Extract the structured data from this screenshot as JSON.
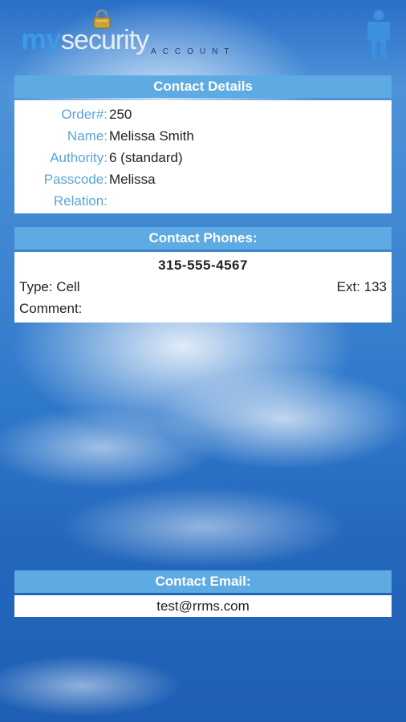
{
  "header": {
    "logo_my": "my",
    "logo_security": "security",
    "logo_account": "ACCOUNT"
  },
  "contact_details": {
    "title": "Contact Details",
    "fields": [
      {
        "label": "Order#:",
        "value": "250"
      },
      {
        "label": "Name:",
        "value": "Melissa Smith"
      },
      {
        "label": "Authority:",
        "value": "6 (standard)"
      },
      {
        "label": "Passcode:",
        "value": "Melissa"
      },
      {
        "label": "Relation:",
        "value": ""
      }
    ]
  },
  "contact_phones": {
    "title": "Contact Phones:",
    "number": "315-555-4567",
    "type": "Type: Cell",
    "ext": "Ext: 133",
    "comment": "Comment:"
  },
  "contact_email": {
    "title": "Contact Email:",
    "address": "test@rrms.com"
  },
  "colors": {
    "section_header": "#5eaae2",
    "label": "#5aa5da",
    "logo_blue": "#3a9be8"
  },
  "icons": [
    "lock-icon",
    "user-icon"
  ]
}
